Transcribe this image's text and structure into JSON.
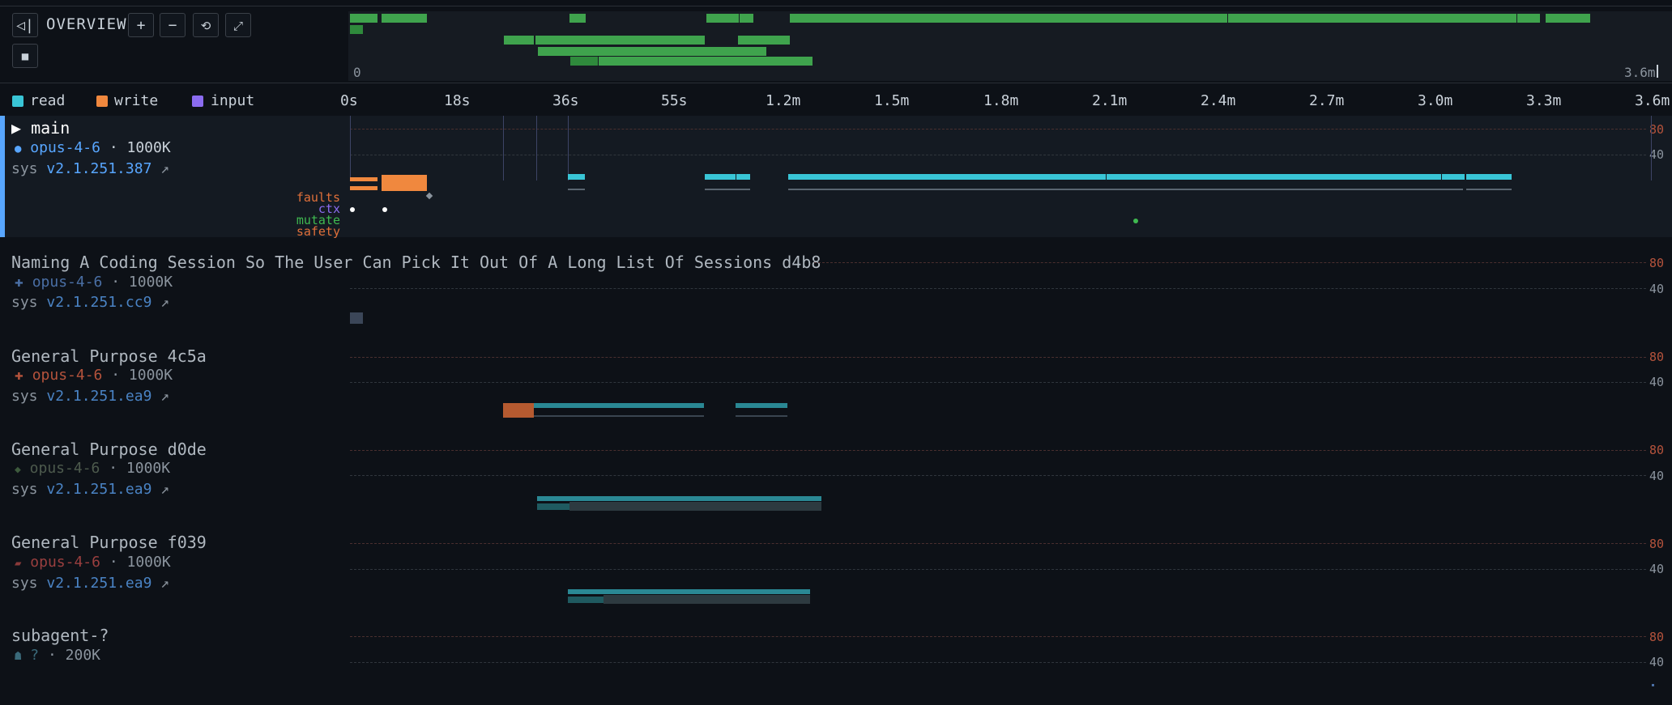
{
  "overview": {
    "collapse_icon": "◁|",
    "label": "OVERVIEW",
    "zoom_in": "+",
    "zoom_out": "−",
    "reset": "⟲",
    "fit": "⤢",
    "square": "■",
    "axis_start": "0",
    "axis_end": "3.6m"
  },
  "legend": [
    {
      "label": "read",
      "color": "#39c5d6"
    },
    {
      "label": "write",
      "color": "#f0883e"
    },
    {
      "label": "input",
      "color": "#8b6cf0"
    }
  ],
  "time_axis": [
    "0s",
    "18s",
    "36s",
    "55s",
    "1.2m",
    "1.5m",
    "1.8m",
    "2.1m",
    "2.4m",
    "2.7m",
    "3.0m",
    "3.3m",
    "3.6m"
  ],
  "y_ticks": {
    "high": "80",
    "mid": "40"
  },
  "main": {
    "title": "▶ main",
    "model_icon": "●",
    "model": "opus-4-6",
    "ctx": "· 1000K",
    "sys_prefix": "sys",
    "version": "v2.1.251.387",
    "link_icon": "↗",
    "signals": [
      {
        "label": "faults",
        "color": "#e0703a"
      },
      {
        "label": "ctx",
        "color": "#8b6cf0"
      },
      {
        "label": "mutate",
        "color": "#3fb950"
      },
      {
        "label": "safety",
        "color": "#e0703a"
      }
    ]
  },
  "subagents": [
    {
      "title": "Naming A Coding Session So The User Can Pick It Out Of A Long List Of Sessions d4b8",
      "icon": "✚",
      "icon_color": "#4a6fa5",
      "model": "opus-4-6",
      "ctx": "· 1000K",
      "sys_prefix": "sys",
      "version": "v2.1.251.cc9",
      "link_icon": "↗"
    },
    {
      "title": "General Purpose 4c5a",
      "icon": "✚",
      "icon_color": "#b5533c",
      "model": "opus-4-6",
      "ctx": "· 1000K",
      "sys_prefix": "sys",
      "version": "v2.1.251.ea9",
      "link_icon": "↗"
    },
    {
      "title": "General Purpose d0de",
      "icon": "◆",
      "icon_color": "#3d5a3d",
      "model": "opus-4-6",
      "ctx": "· 1000K",
      "sys_prefix": "sys",
      "version": "v2.1.251.ea9",
      "link_icon": "↗"
    },
    {
      "title": "General Purpose f039",
      "icon": "▰",
      "icon_color": "#8a3a3a",
      "model": "opus-4-6",
      "ctx": "· 1000K",
      "sys_prefix": "sys",
      "version": "v2.1.251.ea9",
      "link_icon": "↗"
    },
    {
      "title": "subagent-?",
      "icon": "☗",
      "icon_color": "#3a6a7a",
      "model": "?",
      "ctx": "· 200K"
    }
  ]
}
